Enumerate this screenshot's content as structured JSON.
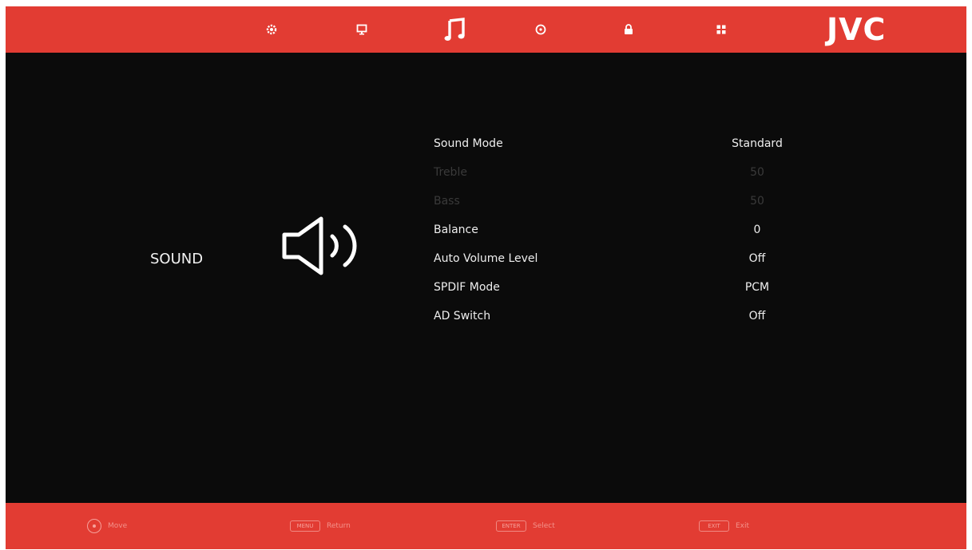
{
  "topbar": {
    "tabs": [
      {
        "name": "settings",
        "icon": "gear-icon"
      },
      {
        "name": "picture",
        "icon": "monitor-icon"
      },
      {
        "name": "sound",
        "icon": "music-note-icon",
        "active": true
      },
      {
        "name": "time",
        "icon": "clock-icon"
      },
      {
        "name": "lock",
        "icon": "lock-icon"
      },
      {
        "name": "apps",
        "icon": "grid-icon"
      }
    ],
    "brand": "JVC"
  },
  "section": {
    "title": "SOUND",
    "icon": "speaker-icon"
  },
  "menu": {
    "items": [
      {
        "label": "Sound Mode",
        "value": "Standard",
        "enabled": true
      },
      {
        "label": "Treble",
        "value": "50",
        "enabled": false
      },
      {
        "label": "Bass",
        "value": "50",
        "enabled": false
      },
      {
        "label": "Balance",
        "value": "0",
        "enabled": true
      },
      {
        "label": "Auto Volume Level",
        "value": "Off",
        "enabled": true
      },
      {
        "label": "SPDIF Mode",
        "value": "PCM",
        "enabled": true
      },
      {
        "label": "AD Switch",
        "value": "Off",
        "enabled": true
      }
    ]
  },
  "bottombar": {
    "hints": [
      {
        "key": "",
        "text": "Move",
        "icon": "dpad-icon"
      },
      {
        "key": "MENU",
        "text": "Return"
      },
      {
        "key": "ENTER",
        "text": "Select"
      },
      {
        "key": "EXIT",
        "text": "Exit"
      }
    ]
  },
  "colors": {
    "accent": "#e23c33",
    "background": "#0b0b0b",
    "text": "#eeeeee",
    "disabled_text": "#3a3a3a"
  }
}
